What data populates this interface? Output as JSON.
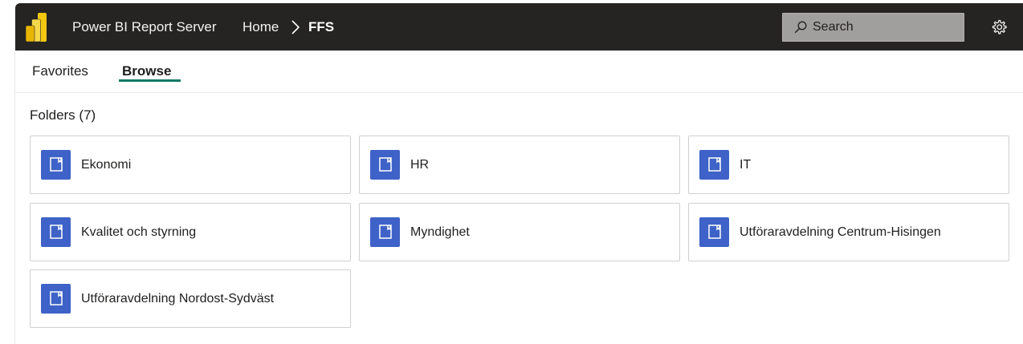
{
  "header": {
    "app_name": "Power BI Report Server",
    "breadcrumb": {
      "home": "Home",
      "current": "FFS"
    },
    "search": {
      "placeholder": "Search"
    },
    "icons": {
      "logo": "power-bi-logo",
      "breadcrumb_separator": "chevron-right-icon",
      "search": "search-icon",
      "settings": "gear-icon"
    },
    "colors": {
      "bar_background": "#252423",
      "logo_yellow": "#f2c811"
    }
  },
  "nav": {
    "tabs": [
      {
        "label": "Favorites",
        "selected": false
      },
      {
        "label": "Browse",
        "selected": true
      }
    ],
    "accent_color": "#117865"
  },
  "main": {
    "section_title": "Folders (7)",
    "folder_icon": "folder-icon",
    "folder_icon_color": "#3e62c7",
    "folders": [
      {
        "label": "Ekonomi"
      },
      {
        "label": "HR"
      },
      {
        "label": "IT"
      },
      {
        "label": "Kvalitet och styrning"
      },
      {
        "label": "Myndighet"
      },
      {
        "label": "Utföraravdelning Centrum-Hisingen"
      },
      {
        "label": "Utföraravdelning Nordost-Sydväst"
      }
    ]
  }
}
